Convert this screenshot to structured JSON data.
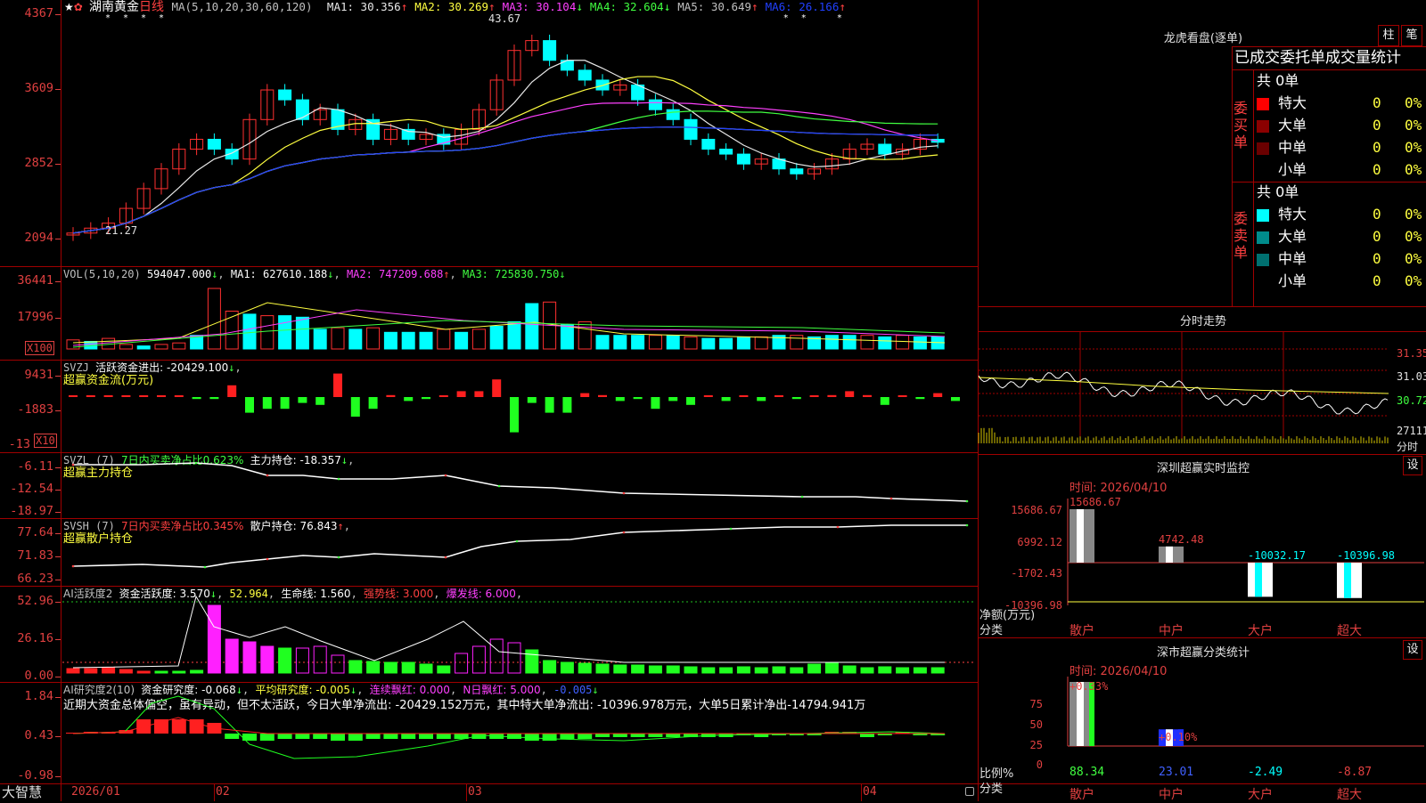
{
  "kline": {
    "star": "★",
    "mark": "✿",
    "stock_name": "湖南黄金",
    "period": "日线",
    "ma_params": "MA(5,10,20,30,60,120)",
    "ma": [
      {
        "label": "MA1: 30.356",
        "arrow": "↑",
        "color": "#e8e8e8"
      },
      {
        "label": "MA2: 30.269",
        "arrow": "↑",
        "color": "#ffff40"
      },
      {
        "label": "MA3: 30.104",
        "arrow": "↓",
        "color": "#ff40ff"
      },
      {
        "label": "MA4: 32.604",
        "arrow": "↓",
        "color": "#40ff40"
      },
      {
        "label": "MA5: 30.649",
        "arrow": "↑",
        "color": "#c0c0c0"
      },
      {
        "label": "MA6: 26.166",
        "arrow": "↑",
        "color": "#2040ff"
      }
    ],
    "y_ticks": [
      "4367",
      "3609",
      "2852",
      "2094"
    ],
    "high_label": "43.67",
    "low_label": "21.27"
  },
  "vol": {
    "title": "VOL(5,10,20)",
    "value": "594047.000",
    "ma1": "MA1: 627610.188",
    "ma2": "MA2: 747209.688",
    "ma3": "MA3: 725830.750",
    "y_ticks": [
      "36441",
      "17996"
    ],
    "unit": "X100"
  },
  "svzj": {
    "title": "SVZJ",
    "line1": "活跃资金进出: -20429.100",
    "subtitle": "超赢资金流(万元)",
    "y_ticks": [
      "9431",
      "-1883",
      "-13"
    ],
    "unit": "X10"
  },
  "svzl": {
    "title": "SVZL (7)",
    "ratio": "7日内买卖净占比0.623%",
    "pos": "主力持仓: -18.357",
    "subtitle": "超赢主力持仓",
    "y_ticks": [
      "-6.11",
      "-12.54",
      "-18.97"
    ]
  },
  "svsh": {
    "title": "SVSH (7)",
    "ratio": "7日内买卖净占比0.345%",
    "pos": "散户持仓: 76.843",
    "subtitle": "超赢散户持仓",
    "y_ticks": [
      "77.64",
      "71.83",
      "66.23"
    ]
  },
  "ai_act": {
    "title": "AI活跃度2",
    "a": "资金活跃度: 3.570",
    "b": "52.964",
    "c": "生命线: 1.560",
    "d": "强势线: 3.000",
    "e": "爆发线: 6.000",
    "y_ticks": [
      "52.96",
      "26.16",
      "0.00"
    ]
  },
  "ai_res": {
    "title": "AI研究度2(10)",
    "a": "资金研究度: -0.068",
    "b": "平均研究度: -0.005",
    "c": "连续飘红: 0.000",
    "d": "N日飘红: 5.000",
    "e": "-0.005",
    "comment": "近期大资金总体偏空，虽有异动，但不太活跃，今日大单净流出: -20429.152万元，其中特大单净流出: -10396.978万元，大单5日累计净出-14794.941万",
    "y_ticks": [
      "1.84",
      "0.43",
      "-0.98"
    ]
  },
  "x_axis": {
    "brand": "大智慧",
    "labels": [
      "2026/01",
      "02",
      "03",
      "04"
    ]
  },
  "dragon": {
    "title": "龙虎看盘(逐单)",
    "btn1": "柱",
    "btn2": "笔",
    "tabs": "已成交委托单成交量统计",
    "buy_label": "委买单",
    "sell_label": "委卖单",
    "buy_total": "共 0单",
    "sell_total": "共 0单",
    "buy_rows": [
      {
        "name": "特大",
        "val": "0",
        "pct": "0%",
        "color": "#ff0000"
      },
      {
        "name": "大单",
        "val": "0",
        "pct": "0%",
        "color": "#8b0000"
      },
      {
        "name": "中单",
        "val": "0",
        "pct": "0%",
        "color": "#6a0000"
      },
      {
        "name": "小单",
        "val": "0",
        "pct": "0%",
        "color": ""
      }
    ],
    "sell_rows": [
      {
        "name": "特大",
        "val": "0",
        "pct": "0%",
        "color": "#00ffff"
      },
      {
        "name": "大单",
        "val": "0",
        "pct": "0%",
        "color": "#008b8b"
      },
      {
        "name": "中单",
        "val": "0",
        "pct": "0%",
        "color": "#007070"
      },
      {
        "name": "小单",
        "val": "0",
        "pct": "0%",
        "color": ""
      }
    ]
  },
  "intraday": {
    "title": "分时走势",
    "y_labels": [
      "31.35",
      "31.03",
      "30.72",
      "27111"
    ],
    "x_label": "分时"
  },
  "monitor": {
    "title": "深圳超赢实时监控",
    "set": "设",
    "time": "时间: 2026/04/10",
    "y_labels": [
      "15686.67",
      "6992.12",
      "-1702.43",
      "-10396.98"
    ],
    "axis_title": "净额(万元)",
    "cat_title": "分类",
    "categories": [
      "散户",
      "中户",
      "大户",
      "超大"
    ],
    "values": [
      15686.67,
      4742.48,
      -10032.17,
      -10396.98
    ],
    "value_labels": [
      "15686.67",
      "4742.48",
      "-10032.17",
      "-10396.98"
    ]
  },
  "classify": {
    "title": "深市超赢分类统计",
    "set": "设",
    "time": "时间: 2026/04/10",
    "y_labels": [
      "75",
      "50",
      "25",
      "0"
    ],
    "axis_title": "比例%",
    "cat_title": "分类",
    "categories": [
      "散户",
      "中户",
      "大户",
      "超大"
    ],
    "top_labels": [
      "+0.33%",
      "+0.10%"
    ],
    "bottom_values": [
      "88.34",
      "23.01",
      "-2.49",
      "-8.87"
    ],
    "values": [
      88.34,
      23.01
    ]
  }
}
